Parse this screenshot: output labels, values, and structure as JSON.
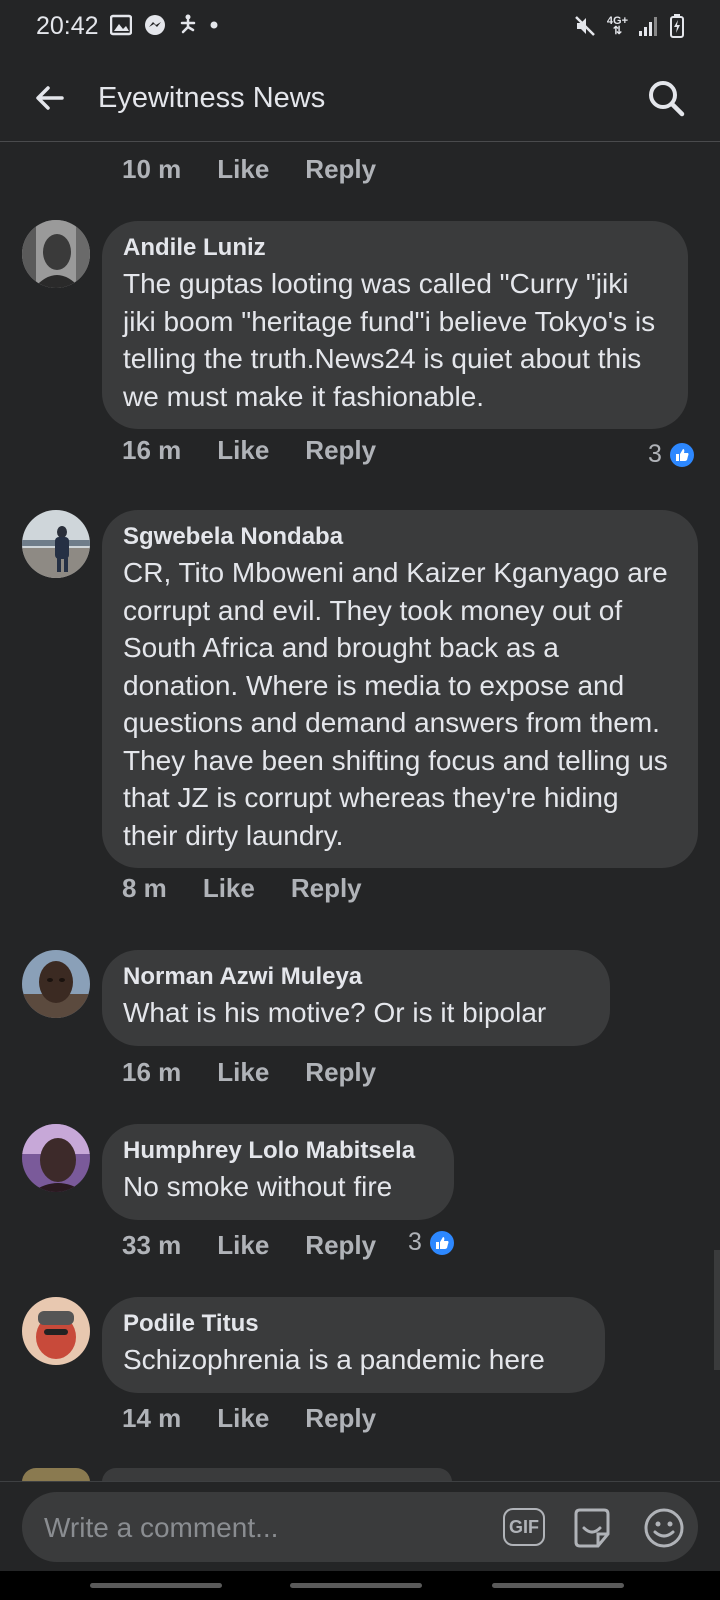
{
  "status_bar": {
    "time": "20:42",
    "network": "4G+"
  },
  "app_bar": {
    "title": "Eyewitness News"
  },
  "previous_comment_actions": {
    "time": "10 m",
    "like": "Like",
    "reply": "Reply"
  },
  "comments": [
    {
      "name": "Andile Luniz",
      "text": "The guptas looting was called \"Curry \"jiki jiki boom \"heritage fund\"i believe Tokyo's is telling the truth.News24 is quiet about this we must make it fashionable.",
      "time": "16 m",
      "like": "Like",
      "reply": "Reply",
      "reactions": "3"
    },
    {
      "name": "Sgwebela Nondaba",
      "text": "CR, Tito Mboweni and Kaizer Kganyago are corrupt and evil. They took money out of South Africa and brought back as a donation. Where is media to expose and questions and demand answers from them. They have been shifting focus and telling us that JZ is corrupt whereas they're hiding their dirty laundry.",
      "time": "8 m",
      "like": "Like",
      "reply": "Reply",
      "reactions": ""
    },
    {
      "name": "Norman Azwi Muleya",
      "text": "What is his motive? Or is it bipolar",
      "time": "16 m",
      "like": "Like",
      "reply": "Reply",
      "reactions": ""
    },
    {
      "name": "Humphrey Lolo Mabitsela",
      "text": "No smoke without fire",
      "time": "33 m",
      "like": "Like",
      "reply": "Reply",
      "reactions": "3"
    },
    {
      "name": "Podile Titus",
      "text": "Schizophrenia is a pandemic here",
      "time": "14 m",
      "like": "Like",
      "reply": "Reply",
      "reactions": ""
    }
  ],
  "composer": {
    "placeholder": "Write a comment...",
    "gif_label": "GIF"
  },
  "colors": {
    "background": "#242526",
    "bubble": "#3a3b3c",
    "like_blue": "#2d88ff",
    "secondary_text": "#b0b3b8"
  }
}
